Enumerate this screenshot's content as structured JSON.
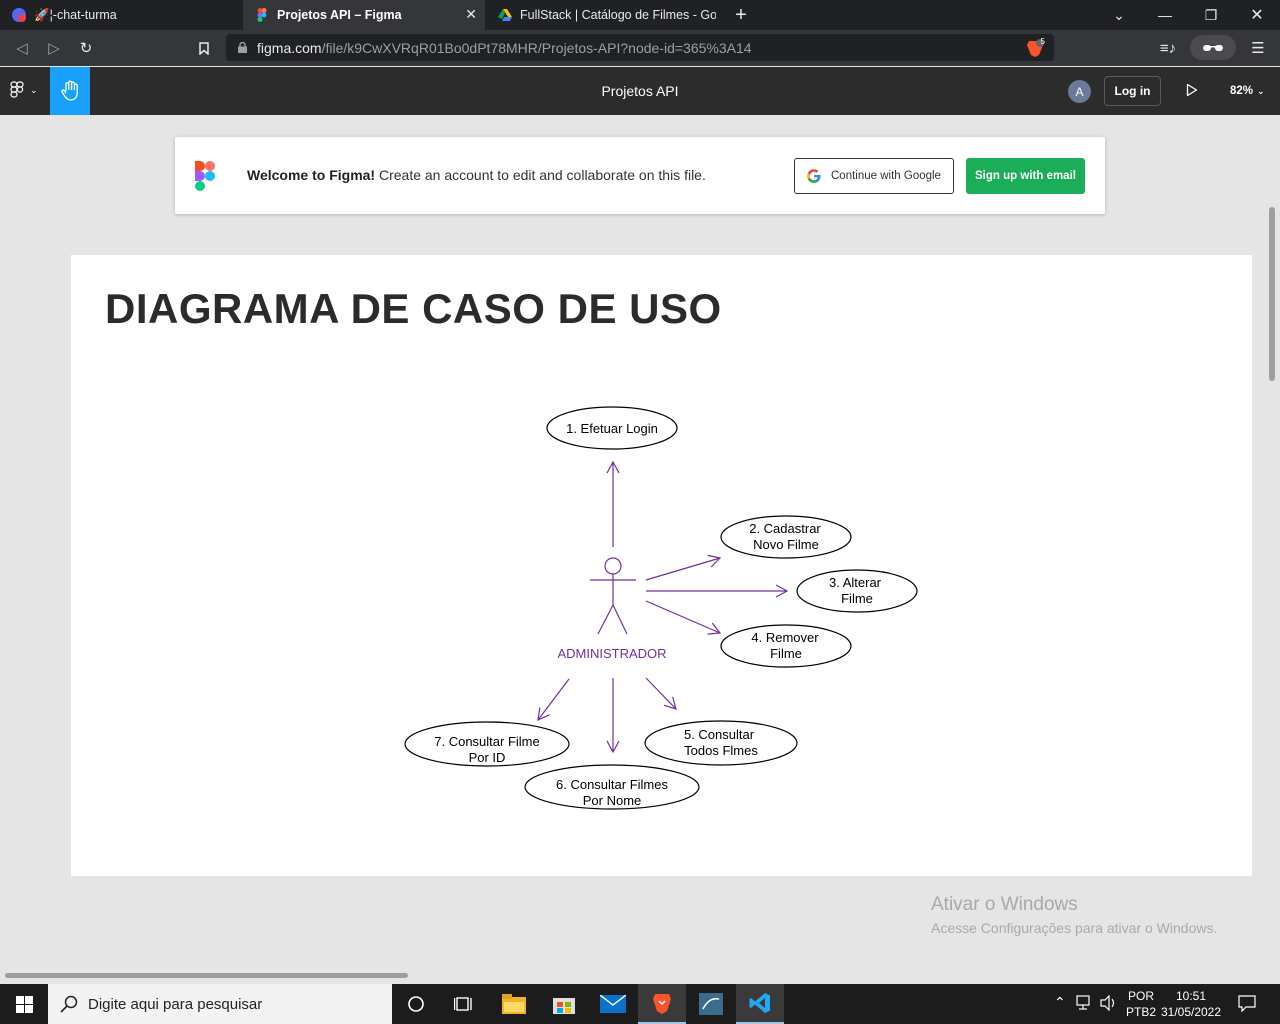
{
  "browser": {
    "tabs": [
      {
        "title": "🚀¦-chat-turma",
        "active": false
      },
      {
        "title": "Projetos API – Figma",
        "active": true
      },
      {
        "title": "FullStack | Catálogo de Filmes - Googl",
        "active": false
      }
    ],
    "url_host": "figma.com",
    "url_path": "/file/k9CwXVRqR01Bo0dPt78MHR/Projetos-API?node-id=365%3A14",
    "shield_count": "5"
  },
  "figma": {
    "file_title": "Projetos API",
    "avatar_initial": "A",
    "login_label": "Log in",
    "zoom": "82%"
  },
  "banner": {
    "welcome_bold": "Welcome to Figma!",
    "welcome_rest": " Create an account to edit and collaborate on this file.",
    "google_label": "Continue with Google",
    "email_label": "Sign up with email"
  },
  "diagram": {
    "title": "DIAGRAMA DE CASO DE USO",
    "actor": "ADMINISTRADOR",
    "accent": "#7030a0",
    "use_cases": [
      {
        "id": "uc1",
        "lines": [
          "1. Efetuar Login"
        ]
      },
      {
        "id": "uc2",
        "lines": [
          "2. Cadastrar",
          "Novo Filme"
        ]
      },
      {
        "id": "uc3",
        "lines": [
          "3. Alterar",
          "Filme"
        ]
      },
      {
        "id": "uc4",
        "lines": [
          "4. Remover",
          "Filme"
        ]
      },
      {
        "id": "uc5",
        "lines": [
          "5. Consultar",
          "Todos Flmes"
        ]
      },
      {
        "id": "uc6",
        "lines": [
          "6. Consultar Filmes",
          "Por Nome"
        ]
      },
      {
        "id": "uc7",
        "lines": [
          "7. Consultar Filme",
          "Por ID"
        ]
      }
    ]
  },
  "watermark": {
    "line1": "Ativar o Windows",
    "line2": "Acesse Configurações para ativar o Windows."
  },
  "taskbar": {
    "search_placeholder": "Digite aqui para pesquisar",
    "lang_top": "POR",
    "lang_bottom": "PTB2",
    "time": "10:51",
    "date": "31/05/2022"
  }
}
